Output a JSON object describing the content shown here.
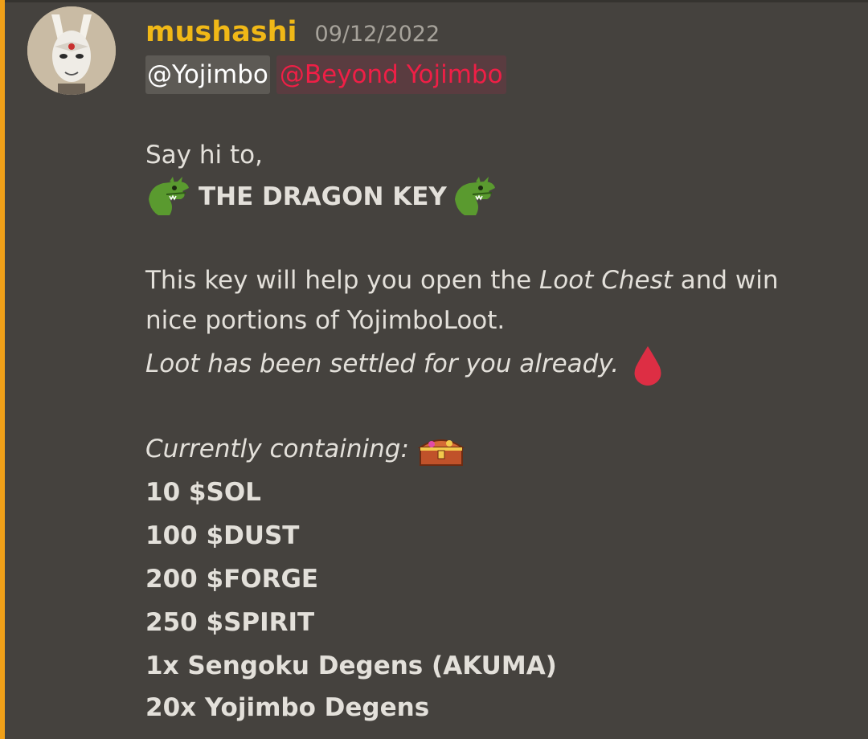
{
  "message": {
    "author": "mushashi",
    "timestamp": "09/12/2022",
    "mentions": {
      "user": "@Yojimbo",
      "role": "@Beyond Yojimbo"
    },
    "greeting": "Say hi to,",
    "title": "THE DRAGON KEY",
    "description_part1": "This key will help you open the",
    "loot_chest": "Loot Chest",
    "description_part2": "and win",
    "description_line2": "nice portions of YojimboLoot.",
    "settled_note": "Loot has been settled for you already.",
    "containing_label": "Currently containing:",
    "loot_items": [
      "10 $SOL",
      "100 $DUST",
      "200 $FORGE",
      "250 $SPIRIT",
      "1x Sengoku Degens (AKUMA)",
      "20x Yojimbo Degens"
    ]
  },
  "colors": {
    "background": "#45423e",
    "accent_bar": "#f0a019",
    "username": "#f0b817",
    "role_mention": "#ef1f46",
    "text": "#e3e0da"
  },
  "icons": {
    "title_left": "dragon-face-icon",
    "title_right": "dragon-face-icon",
    "settled": "blood-drop-icon",
    "containing": "treasure-chest-icon"
  }
}
